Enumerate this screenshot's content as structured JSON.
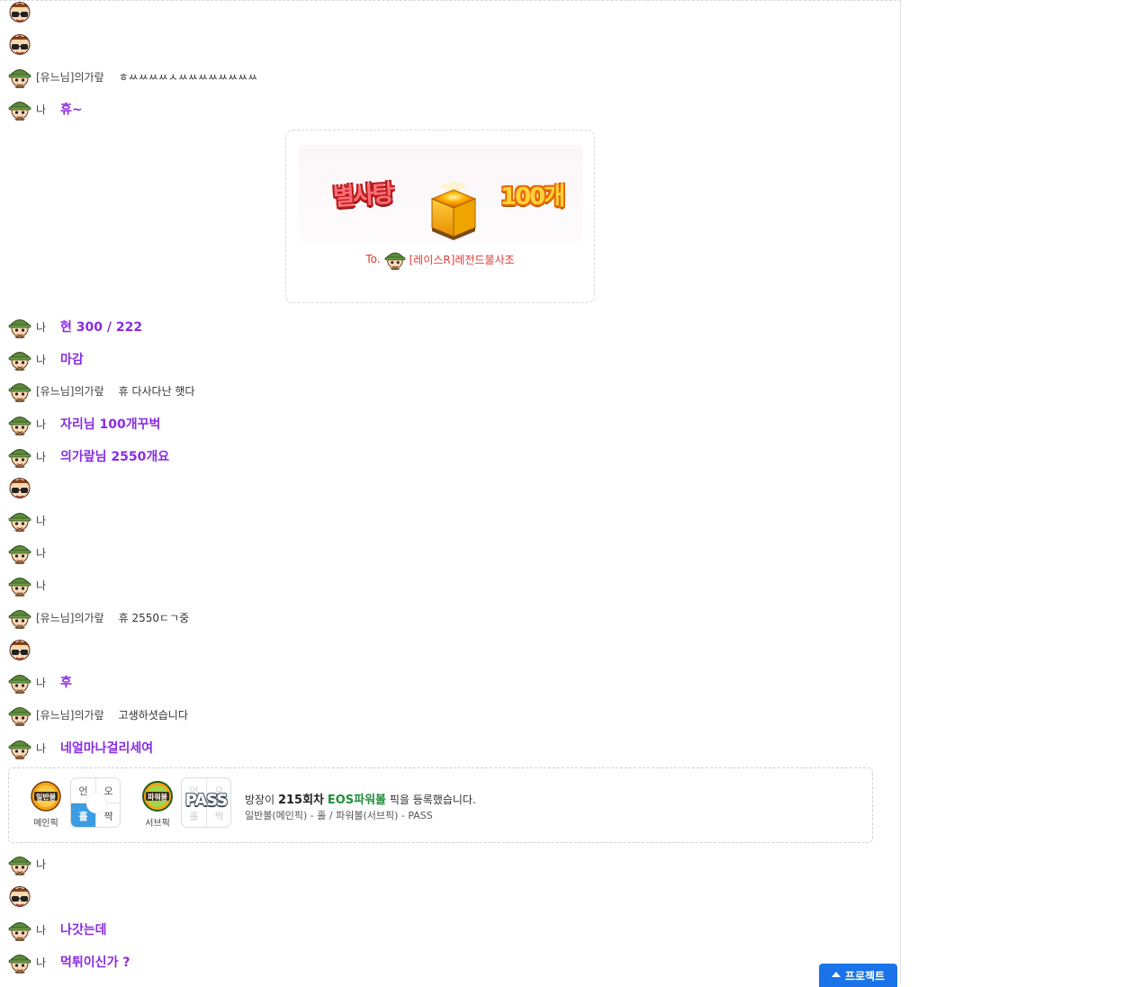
{
  "colors": {
    "me_text": "#8a2be2",
    "gift_text": "#e53935",
    "game_name": "#1f8f3a",
    "button": "#1a73e8"
  },
  "messages": [
    {
      "avatar": "host-avatar",
      "nick": "",
      "text": "",
      "style": "normal"
    },
    {
      "avatar": "host-avatar",
      "nick": "",
      "text": "",
      "style": "normal"
    },
    {
      "avatar": "soldier-avatar",
      "nick": "[유느님]의가랖",
      "text": "ㅎㅆㅆㅆㅆㅅㅆㅆㅆㅆㅆㅆㅆㅆ",
      "style": "normal"
    },
    {
      "avatar": "soldier-avatar",
      "nick": "나",
      "text": "휴~",
      "style": "me"
    },
    {
      "avatar": "soldier-avatar",
      "nick": "나",
      "text": "현 300 / 222",
      "style": "me"
    },
    {
      "avatar": "soldier-avatar",
      "nick": "나",
      "text": "마감",
      "style": "me"
    },
    {
      "avatar": "soldier-avatar",
      "nick": "[유느님]의가랖",
      "text": "휴 다사다난 햇다",
      "style": "normal"
    },
    {
      "avatar": "soldier-avatar",
      "nick": "나",
      "text": "자리님 100개꾸벅",
      "style": "me"
    },
    {
      "avatar": "soldier-avatar",
      "nick": "나",
      "text": "의가랖님 2550개요",
      "style": "me"
    },
    {
      "avatar": "host-avatar",
      "nick": "",
      "text": "",
      "style": "normal"
    },
    {
      "avatar": "soldier-avatar",
      "nick": "나",
      "text": "",
      "style": "me"
    },
    {
      "avatar": "soldier-avatar",
      "nick": "나",
      "text": "",
      "style": "me"
    },
    {
      "avatar": "soldier-avatar",
      "nick": "나",
      "text": "",
      "style": "me"
    },
    {
      "avatar": "soldier-avatar",
      "nick": "[유느님]의가랖",
      "text": "휴 2550ㄷㄱ중",
      "style": "normal"
    },
    {
      "avatar": "host-avatar",
      "nick": "",
      "text": "",
      "style": "normal"
    },
    {
      "avatar": "soldier-avatar",
      "nick": "나",
      "text": "후",
      "style": "me"
    },
    {
      "avatar": "soldier-avatar",
      "nick": "[유느님]의가랖",
      "text": "고생하셧습니다",
      "style": "normal"
    },
    {
      "avatar": "soldier-avatar",
      "nick": "나",
      "text": "네얼마나걸리세여",
      "style": "me"
    },
    {
      "avatar": "soldier-avatar",
      "nick": "나",
      "text": "",
      "style": "me"
    },
    {
      "avatar": "host-avatar",
      "nick": "",
      "text": "",
      "style": "normal"
    },
    {
      "avatar": "soldier-avatar",
      "nick": "나",
      "text": "나갓는데",
      "style": "me"
    },
    {
      "avatar": "soldier-avatar",
      "nick": "나",
      "text": "먹튀이신가 ?",
      "style": "me"
    }
  ],
  "gift": {
    "title": "별사탕",
    "count": "100개",
    "to_prefix": "To.",
    "recipient": "[레이스R]레전드불사조",
    "icon": "gift-box-icon"
  },
  "pick": {
    "main_ball_label": "일반볼",
    "main_caption": "메인픽",
    "main_grid": [
      "언",
      "오",
      "홀",
      "짝"
    ],
    "main_selected": "홀",
    "sub_ball_label": "파워볼",
    "sub_caption": "서브픽",
    "sub_grid": [
      "언",
      "오",
      "홀",
      "짝"
    ],
    "sub_pass_label": "PASS",
    "line1_prefix": "방장이",
    "round": "215회차",
    "game": "EOS파워볼",
    "line1_suffix": "픽을 등록했습니다.",
    "line2": "일반볼(메인픽) - 홀 / 파워볼(서브픽) - PASS"
  },
  "project_button": {
    "label": "프로젝트",
    "icon": "triangle-up-icon"
  }
}
